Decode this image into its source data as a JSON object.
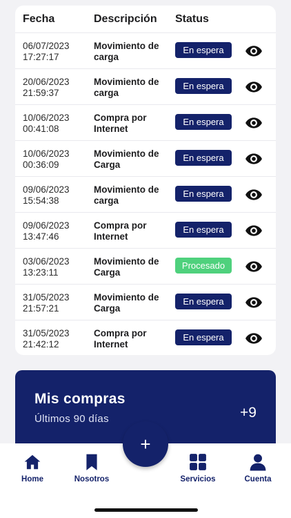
{
  "table": {
    "headers": {
      "fecha": "Fecha",
      "descripcion": "Descripción",
      "status": "Status"
    },
    "rows": [
      {
        "date": "06/07/2023",
        "time": "17:27:17",
        "desc1": "Movimiento de",
        "desc2": "carga",
        "status": "En espera",
        "state": "wait"
      },
      {
        "date": "20/06/2023",
        "time": "21:59:37",
        "desc1": "Movimiento de",
        "desc2": "carga",
        "status": "En espera",
        "state": "wait"
      },
      {
        "date": "10/06/2023",
        "time": "00:41:08",
        "desc1": "Compra por",
        "desc2": "Internet",
        "status": "En espera",
        "state": "wait"
      },
      {
        "date": "10/06/2023",
        "time": "00:36:09",
        "desc1": "Movimiento de",
        "desc2": "Carga",
        "status": "En espera",
        "state": "wait"
      },
      {
        "date": "09/06/2023",
        "time": "15:54:38",
        "desc1": "Movimiento de",
        "desc2": "carga",
        "status": "En espera",
        "state": "wait"
      },
      {
        "date": "09/06/2023",
        "time": "13:47:46",
        "desc1": "Compra por",
        "desc2": "Internet",
        "status": "En espera",
        "state": "wait"
      },
      {
        "date": "03/06/2023",
        "time": "13:23:11",
        "desc1": "Movimiento de",
        "desc2": "Carga",
        "status": "Procesado",
        "state": "ok"
      },
      {
        "date": "31/05/2023",
        "time": "21:57:21",
        "desc1": "Movimiento de",
        "desc2": "Carga",
        "status": "En espera",
        "state": "wait"
      },
      {
        "date": "31/05/2023",
        "time": "21:42:12",
        "desc1": "Compra por",
        "desc2": "Internet",
        "status": "En espera",
        "state": "wait"
      }
    ]
  },
  "banner": {
    "title": "Mis compras",
    "subtitle": "Últimos 90 días",
    "count": "+9"
  },
  "tabs": [
    {
      "label": "Home",
      "icon": "home-icon"
    },
    {
      "label": "Nosotros",
      "icon": "bookmark-icon"
    },
    {
      "label": "Servicios",
      "icon": "grid-icon"
    },
    {
      "label": "Cuenta",
      "icon": "user-icon"
    }
  ],
  "fab": {
    "label": "+"
  },
  "colors": {
    "primary": "#14226a",
    "success": "#4fd17d",
    "background": "#f2f2f5"
  }
}
